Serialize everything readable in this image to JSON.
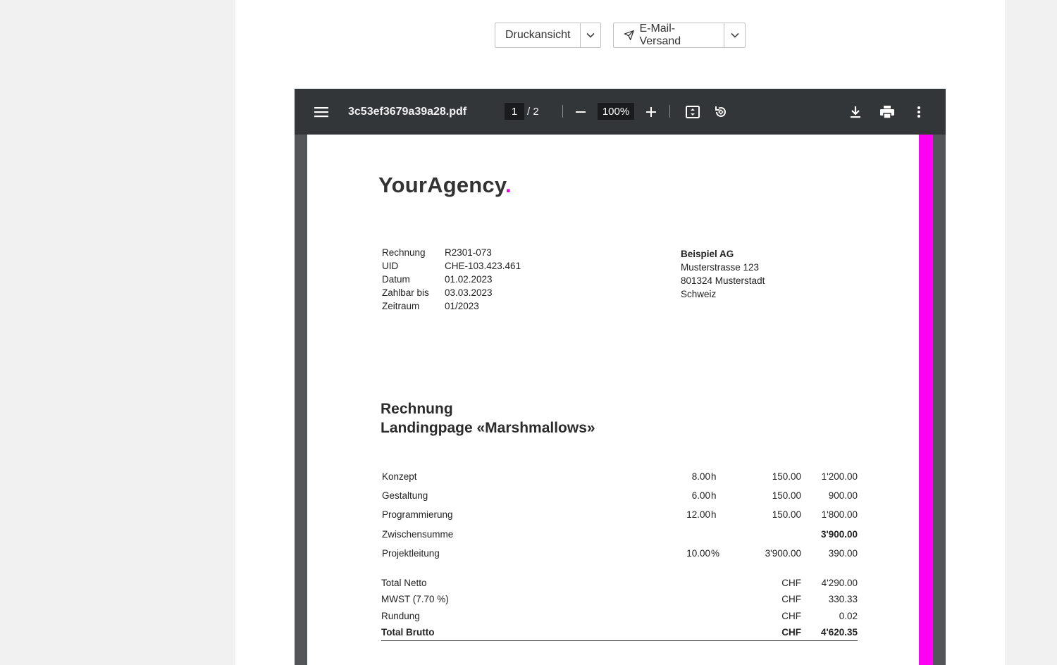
{
  "actions": {
    "print_view_label": "Druckansicht",
    "email_label": "E-Mail-Versand"
  },
  "viewer": {
    "file_name": "3c53ef3679a39a28.pdf",
    "current_page": "1",
    "page_total": "/  2",
    "zoom": "100%"
  },
  "invoice": {
    "logo_text": "YourAgency",
    "logo_dot": ".",
    "meta": [
      {
        "label": "Rechnung",
        "value": "R2301-073"
      },
      {
        "label": "UID",
        "value": "CHE-103.423.461"
      },
      {
        "label": "Datum",
        "value": "01.02.2023"
      },
      {
        "label": "Zahlbar bis",
        "value": "03.03.2023"
      },
      {
        "label": "Zeitraum",
        "value": "01/2023"
      }
    ],
    "recipient": {
      "name": "Beispiel AG",
      "street": "Musterstrasse 123",
      "city": "801324 Musterstadt",
      "country": "Schweiz"
    },
    "title_line1": "Rechnung",
    "title_line2": "Landingpage «Marshmallows»",
    "items": [
      {
        "name": "Konzept",
        "qty": "8.00",
        "unit": "h",
        "rate": "150.00",
        "total": "1'200.00"
      },
      {
        "name": "Gestaltung",
        "qty": "6.00",
        "unit": "h",
        "rate": "150.00",
        "total": "900.00"
      },
      {
        "name": "Programmierung",
        "qty": "12.00",
        "unit": "h",
        "rate": "150.00",
        "total": "1'800.00"
      },
      {
        "name": "Zwischensumme",
        "qty": "",
        "unit": "",
        "rate": "",
        "total": "3'900.00"
      },
      {
        "name": "Projektleitung",
        "qty": "10.00",
        "unit": "%",
        "rate": "3'900.00",
        "total": "390.00"
      }
    ],
    "totals": [
      {
        "label": "Total Netto",
        "currency": "CHF",
        "amount": "4'290.00"
      },
      {
        "label": "MWST (7.70 %)",
        "currency": "CHF",
        "amount": "330.33"
      },
      {
        "label": "Rundung",
        "currency": "CHF",
        "amount": "0.02"
      },
      {
        "label": "Total Brutto",
        "currency": "CHF",
        "amount": "4'620.35"
      }
    ]
  },
  "colors": {
    "accent_magenta": "#ff00f2",
    "viewer_toolbar": "#323639",
    "viewer_background": "#525659"
  },
  "icons": [
    "chevron-down-icon",
    "send-icon",
    "menu-icon",
    "minus-icon",
    "plus-icon",
    "fit-page-icon",
    "rotate-icon",
    "download-icon",
    "print-icon",
    "more-vert-icon"
  ]
}
